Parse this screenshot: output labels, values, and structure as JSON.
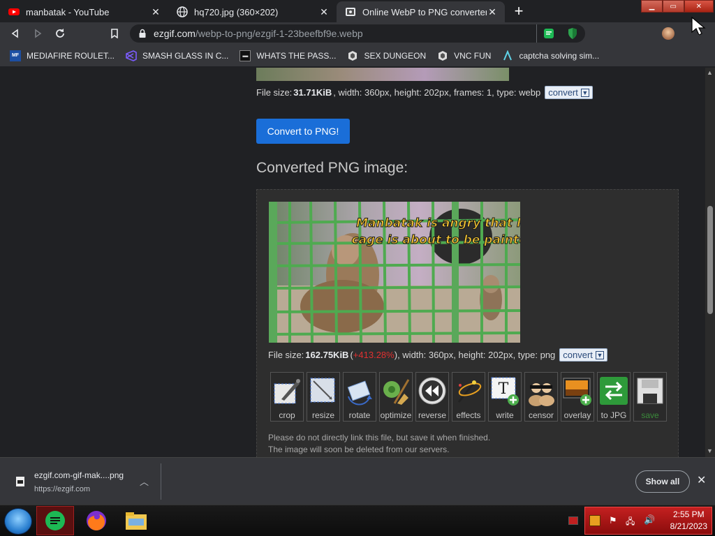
{
  "tabs": [
    {
      "title": "manbatak - YouTube",
      "icon": "youtube-icon",
      "active": false
    },
    {
      "title": "hq720.jpg (360×202)",
      "icon": "globe-icon",
      "active": false
    },
    {
      "title": "Online WebP to PNG converter",
      "icon": "ezgif-icon",
      "active": true
    }
  ],
  "address": {
    "host": "ezgif.com",
    "path": "/webp-to-png/ezgif-1-23beefbf9e.webp"
  },
  "bookmarks": [
    {
      "label": "MEDIAFIRE ROULET...",
      "icon": "mediafire-icon"
    },
    {
      "label": "SMASH GLASS IN C...",
      "icon": "visual-studio-icon"
    },
    {
      "label": "WHATS THE PASS...",
      "icon": "terminal-icon"
    },
    {
      "label": "SEX DUNGEON",
      "icon": "vnc-icon"
    },
    {
      "label": "VNC FUN",
      "icon": "vnc-icon"
    },
    {
      "label": "captcha solving sim...",
      "icon": "lambda-icon"
    }
  ],
  "source_file": {
    "prefix": "File size: ",
    "size": "31.71KiB",
    "details": ", width: 360px, height: 202px, frames: 1, type: webp",
    "convert_label": "convert"
  },
  "convert_button": "Convert to PNG!",
  "result_heading": "Converted PNG image:",
  "image_caption": {
    "line1": "Manbatak is angry that his",
    "line2": "cage is about to be painted!"
  },
  "result_file": {
    "prefix": "File size: ",
    "size": "162.75KiB",
    "delta_open": " (",
    "delta": "+413.28%",
    "delta_close": ")",
    "details": ", width: 360px, height: 202px, type: png",
    "convert_label": "convert"
  },
  "tools": [
    {
      "label": "crop",
      "icon": "crop-icon"
    },
    {
      "label": "resize",
      "icon": "resize-icon"
    },
    {
      "label": "rotate",
      "icon": "rotate-icon"
    },
    {
      "label": "optimize",
      "icon": "optimize-icon"
    },
    {
      "label": "reverse",
      "icon": "reverse-icon"
    },
    {
      "label": "effects",
      "icon": "effects-icon"
    },
    {
      "label": "write",
      "icon": "write-icon"
    },
    {
      "label": "censor",
      "icon": "censor-icon"
    },
    {
      "label": "overlay",
      "icon": "overlay-icon"
    },
    {
      "label": "to JPG",
      "icon": "to-jpg-icon"
    },
    {
      "label": "save",
      "icon": "save-icon"
    }
  ],
  "note": {
    "line1": "Please do not directly link this file, but save it when finished.",
    "line2": "The image will soon be deleted from our servers."
  },
  "download": {
    "filename": "ezgif.com-gif-mak....png",
    "url": "https://ezgif.com",
    "show_all": "Show all"
  },
  "clock": {
    "time": "2:55 PM",
    "date": "8/21/2023"
  },
  "colors": {
    "accent": "#1a6ed8",
    "delta_red": "#e03030",
    "tray_red": "#c42020"
  }
}
